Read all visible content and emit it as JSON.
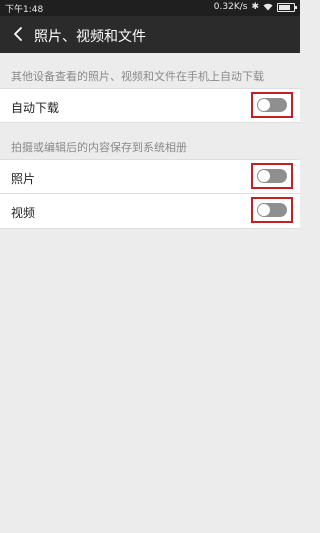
{
  "status_bar": {
    "time": "下午1:48",
    "net_speed": "0.32K/s",
    "icons": [
      "bluetooth-icon",
      "wifi-icon",
      "battery-icon"
    ]
  },
  "header": {
    "title": "照片、视频和文件"
  },
  "section1": {
    "label": "其他设备查看的照片、视频和文件在手机上自动下载",
    "items": [
      {
        "label": "自动下载",
        "enabled": false
      }
    ]
  },
  "section2": {
    "label": "拍摄或编辑后的内容保存到系统相册",
    "items": [
      {
        "label": "照片",
        "enabled": false
      },
      {
        "label": "视频",
        "enabled": false
      }
    ]
  },
  "colors": {
    "title_bar": "#2b2b2b",
    "highlight_border": "#c62026",
    "toggle_off": "#8f8f8f",
    "background": "#ececec"
  }
}
